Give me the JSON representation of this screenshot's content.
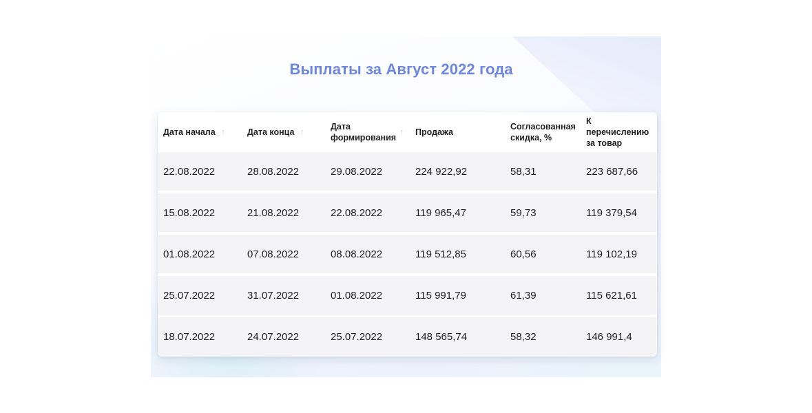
{
  "title": "Выплаты за Август 2022 года",
  "table": {
    "headers": [
      {
        "label": "Дата начала",
        "sortable": true,
        "sort_icon": "arrow-up-icon"
      },
      {
        "label": "Дата конца",
        "sortable": true,
        "sort_icon": "arrow-up-icon"
      },
      {
        "label": "Дата формирования",
        "sortable": true,
        "sort_icon": "arrow-up-icon"
      },
      {
        "label": "Продажа",
        "sortable": false
      },
      {
        "label": "Согласованная скидка, %",
        "sortable": false
      },
      {
        "label": "К перечислению за товар",
        "sortable": false
      }
    ],
    "sort_arrow": "↑",
    "rows": [
      [
        "22.08.2022",
        "28.08.2022",
        "29.08.2022",
        "224 922,92",
        "58,31",
        "223 687,66"
      ],
      [
        "15.08.2022",
        "21.08.2022",
        "22.08.2022",
        "119 965,47",
        "59,73",
        "119 379,54"
      ],
      [
        "01.08.2022",
        "07.08.2022",
        "08.08.2022",
        "119 512,85",
        "60,56",
        "119 102,19"
      ],
      [
        "25.07.2022",
        "31.07.2022",
        "01.08.2022",
        "115 991,79",
        "61,39",
        "115 621,61"
      ],
      [
        "18.07.2022",
        "24.07.2022",
        "25.07.2022",
        "148 565,74",
        "58,32",
        "146 991,4"
      ]
    ]
  },
  "colors": {
    "title": "#6d86e0",
    "row_background": "#f4f4f6",
    "card_background": "#ffffff",
    "sort_arrow": "#d2d4da"
  }
}
